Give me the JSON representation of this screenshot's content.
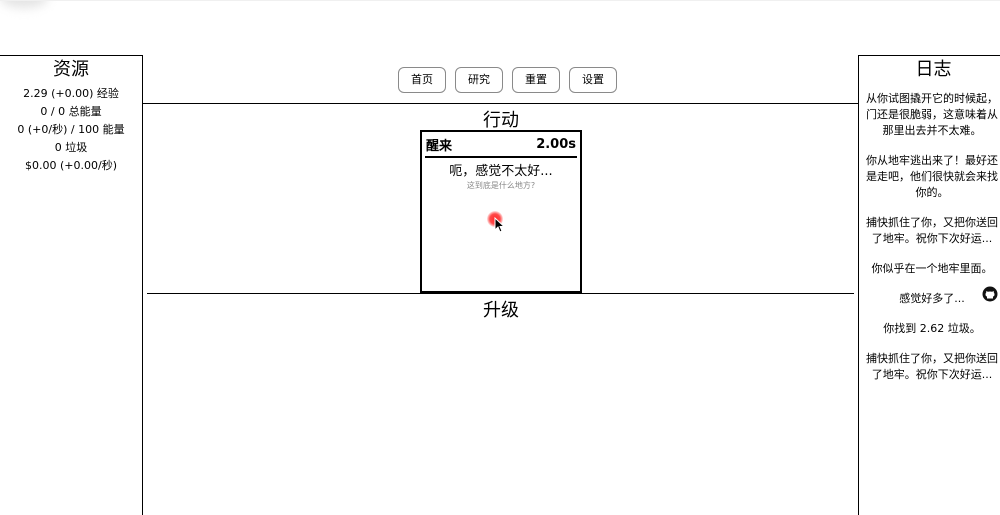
{
  "resources": {
    "title": "资源",
    "lines": [
      "2.29 (+0.00) 经验",
      "0 / 0 总能量",
      "0 (+0/秒) / 100 能量",
      "0 垃圾",
      "$0.00 (+0.00/秒)"
    ]
  },
  "nav": {
    "home": "首页",
    "research": "研究",
    "reset": "重置",
    "settings": "设置"
  },
  "actions": {
    "title": "行动",
    "card": {
      "name": "醒来",
      "time": "2.00s",
      "text": "呃，感觉不太好...",
      "subtext": "这到底是什么地方?"
    }
  },
  "upgrades": {
    "title": "升级"
  },
  "log": {
    "title": "日志",
    "entries": [
      "从你试图撬开它的时候起，门还是很脆弱，这意味着从那里出去并不太难。",
      "你从地牢逃出来了！最好还是走吧，他们很快就会来找你的。",
      "捕快抓住了你，又把你送回了地牢。祝你下次好运...",
      "你似乎在一个地牢里面。",
      "感觉好多了...",
      "你找到 2.62 垃圾。",
      "捕快抓住了你，又把你送回了地牢。祝你下次好运..."
    ]
  },
  "icons": {
    "cursor": "mouse-pointer-icon",
    "github": "github-icon"
  },
  "colors": {
    "click_indicator": "#ff2a2a"
  }
}
